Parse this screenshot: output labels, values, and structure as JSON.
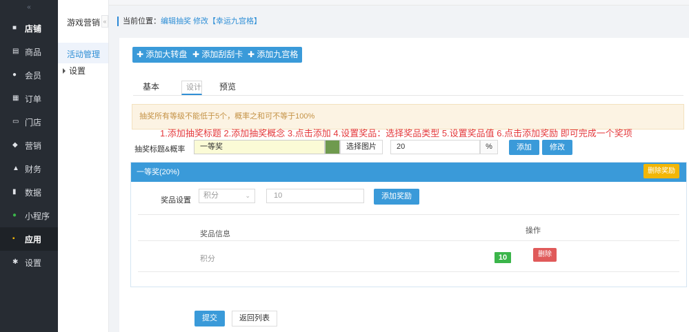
{
  "sidebar": {
    "collapse_icon": "collapse-arrows-icon",
    "items": [
      {
        "label": "店铺",
        "icon": "shop-icon",
        "bold": true
      },
      {
        "label": "商品",
        "icon": "goods-icon",
        "bold": false
      },
      {
        "label": "会员",
        "icon": "member-icon",
        "bold": false
      },
      {
        "label": "订单",
        "icon": "order-icon",
        "bold": false
      },
      {
        "label": "门店",
        "icon": "store-icon",
        "bold": false
      },
      {
        "label": "营销",
        "icon": "marketing-icon",
        "bold": false
      },
      {
        "label": "财务",
        "icon": "finance-icon",
        "bold": false
      },
      {
        "label": "数据",
        "icon": "data-icon",
        "bold": false
      },
      {
        "label": "小程序",
        "icon": "miniprogram-icon",
        "bold": false
      },
      {
        "label": "应用",
        "icon": "apps-icon",
        "bold": true,
        "active": true
      },
      {
        "label": "设置",
        "icon": "settings-icon",
        "bold": false
      }
    ]
  },
  "subnav": {
    "title": "游戏营销",
    "items": [
      {
        "label": "活动管理",
        "active": true
      },
      {
        "label": "设置",
        "active": false
      }
    ]
  },
  "breadcrumb": {
    "prefix": "当前位置：",
    "link": "编辑抽奖",
    "current": "修改【幸运九宫格】"
  },
  "toolbar": {
    "add_wheel": "添加大转盘",
    "add_scratch": "添加刮刮卡",
    "add_grid": "添加九宫格"
  },
  "tabs": [
    "基本",
    "设计",
    "预览"
  ],
  "selected_tab": "设计",
  "notice": "抽奖所有等级不能低于5个，概率之和可不等于100%",
  "instruction": "1.添加抽奖标题 2.添加抽奖概念 3.点击添加 4.设置奖品：选择奖品类型 5.设置奖品值 6.点击添加奖励 即可完成一个奖项",
  "form": {
    "title_label": "抽奖标题&概率",
    "title_value": "一等奖",
    "pick_image": "选择图片",
    "prob_value": "20",
    "percent": "%",
    "add": "添加",
    "modify": "修改"
  },
  "prize": {
    "header": "一等奖(20%)",
    "delete_label": "删除奖励",
    "setting_label": "奖品设置",
    "type_selected": "积分",
    "value": "10",
    "add_reward": "添加奖励",
    "col_info": "奖品信息",
    "col_action": "操作",
    "rows": [
      {
        "info": "积分",
        "value": "10",
        "delete": "删除"
      }
    ]
  },
  "footer": {
    "submit": "提交",
    "back": "返回列表"
  },
  "colors": {
    "primary": "#3a9ad9",
    "sidebar": "#272c33",
    "warn_bg": "#fcf3e3",
    "delete_yellow": "#f2b606",
    "delete_red": "#e05a5a",
    "tag_green": "#3bb54a",
    "red_text": "#e4393c"
  }
}
